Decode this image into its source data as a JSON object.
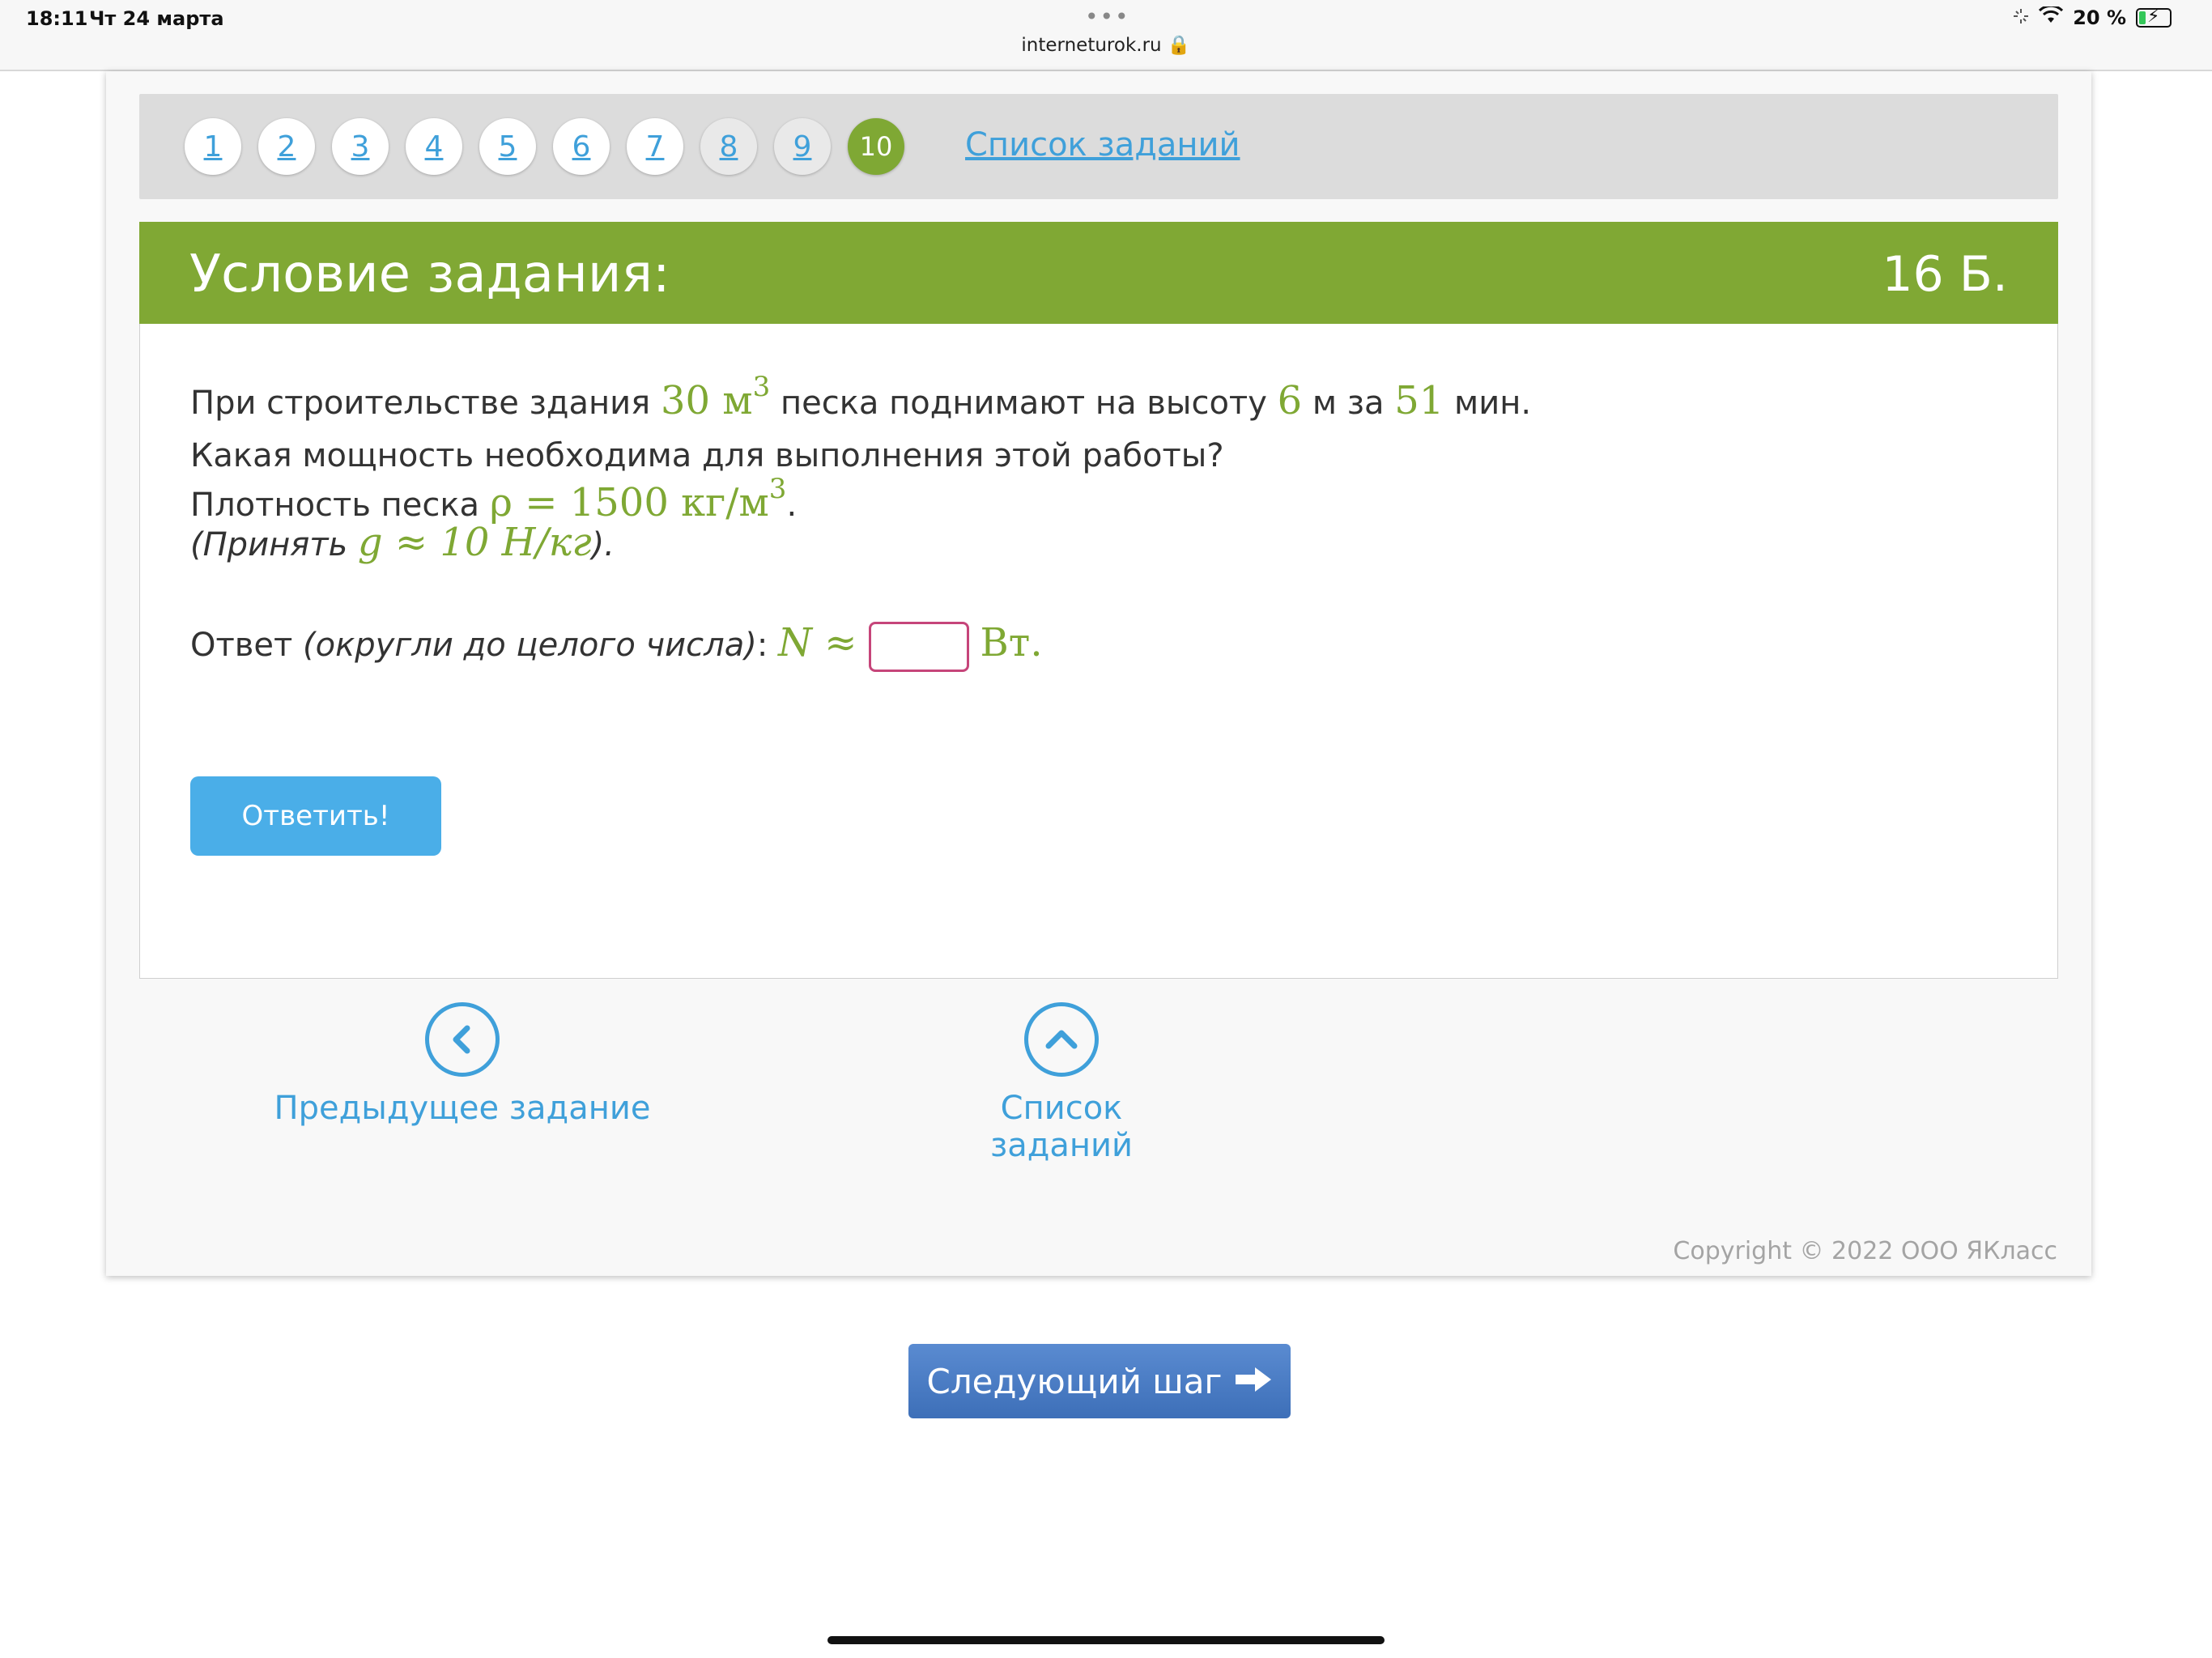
{
  "status_bar": {
    "time": "18:11",
    "date": "Чт 24 марта",
    "url": "interneturok.ru 🔒",
    "battery": "20 %"
  },
  "nav": {
    "numbers": [
      "1",
      "2",
      "3",
      "4",
      "5",
      "6",
      "7",
      "8",
      "9",
      "10"
    ],
    "active": "10",
    "task_list_link": "Список заданий"
  },
  "task": {
    "title": "Условие задания:",
    "points": "16 Б.",
    "line1": {
      "t1": "При строительстве здания ",
      "m1": "30 м",
      "m1_sup": "3",
      "t2": " песка поднимают на высоту ",
      "m2": "6",
      "t3": " м за ",
      "m3": "51",
      "t4": " мин."
    },
    "line2": "Какая мощность необходима для выполнения этой работы?",
    "line3": {
      "t1": "Плотность песка ",
      "m1": "ρ = 1500 кг/м",
      "m1_sup": "3",
      "t2": "."
    },
    "line4": {
      "t1": "(Принять ",
      "m1": "g ≈ 10 Н/кг",
      "t2": ")."
    },
    "answer": {
      "label": "Ответ ",
      "hint": "(округли до целого числа)",
      "colon": ": ",
      "symbol": "N ≈",
      "unit": "Вт.",
      "value": ""
    },
    "submit_label": "Ответить!"
  },
  "bottom_nav": {
    "prev": "Предыдущее задание",
    "list": "Список заданий"
  },
  "copyright": "Copyright © 2022 ООО ЯКласс",
  "next_step": "Следующий шаг",
  "colors": {
    "green": "#80a834",
    "blue": "#3fa0da",
    "button_blue": "#4aaee8",
    "input_border": "#c6457a"
  }
}
